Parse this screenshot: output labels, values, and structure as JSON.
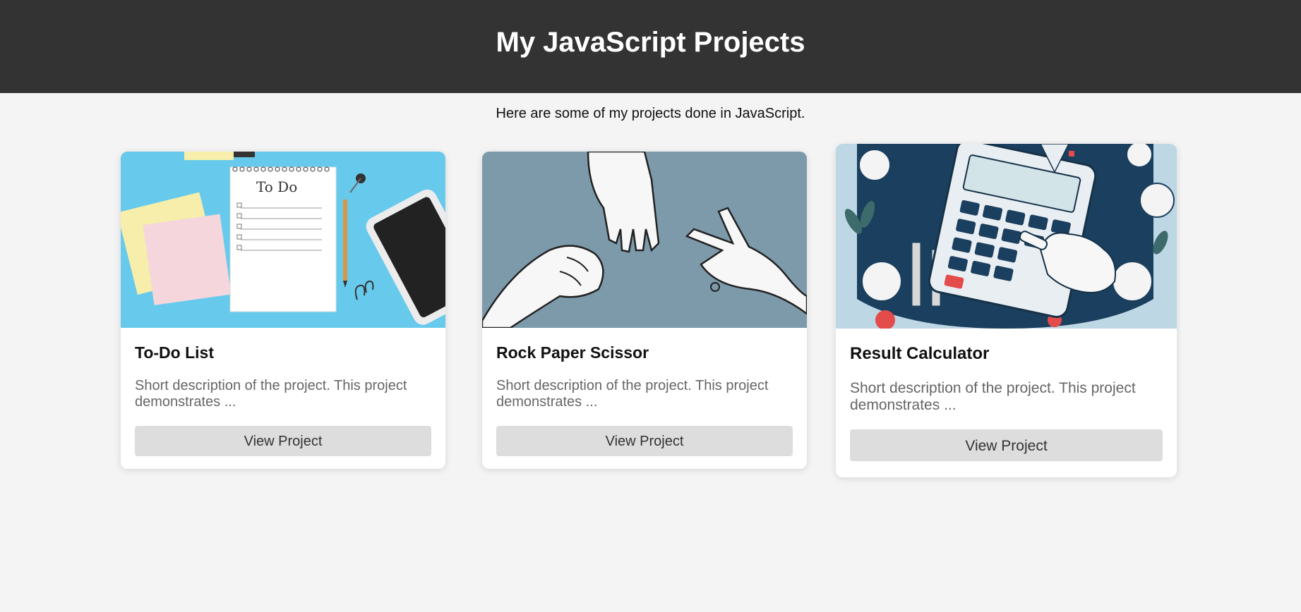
{
  "header": {
    "title": "My JavaScript Projects"
  },
  "intro": "Here are some of my projects done in JavaScript.",
  "projects": [
    {
      "title": "To-Do List",
      "description": "Short description of the project. This project demonstrates ...",
      "button_label": "View Project",
      "image_icon": "todo-notebook-image",
      "image_text": "To Do"
    },
    {
      "title": "Rock Paper Scissor",
      "description": "Short description of the project. This project demonstrates ...",
      "button_label": "View Project",
      "image_icon": "rock-paper-scissors-hands-image"
    },
    {
      "title": "Result Calculator",
      "description": "Short description of the project. This project demonstrates ...",
      "button_label": "View Project",
      "image_icon": "calculator-infographic-image"
    }
  ],
  "colors": {
    "header_bg": "#333333",
    "page_bg": "#f4f4f4",
    "button_bg": "#dddddd"
  }
}
